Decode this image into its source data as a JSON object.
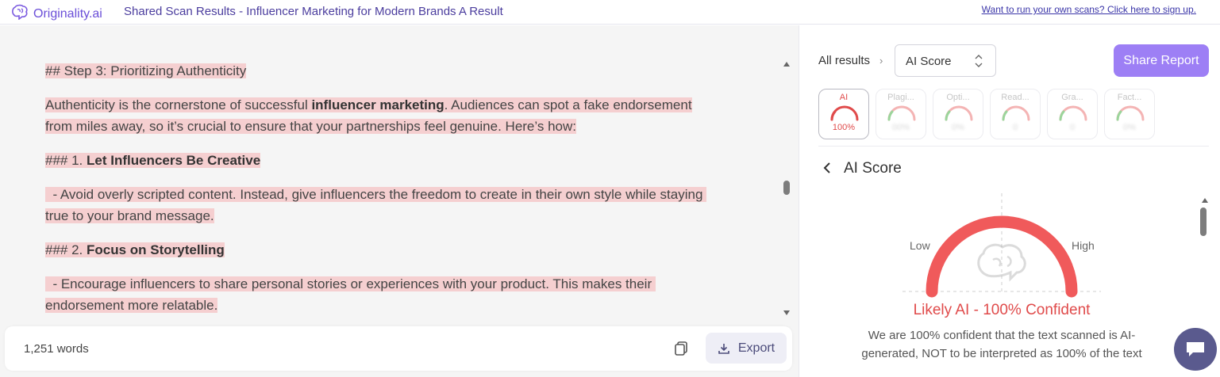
{
  "header": {
    "brand": "Originality.ai",
    "title": "Shared Scan Results - Influencer Marketing for Modern Brands A Result",
    "signup_link": "Want to run your own scans? Click here to sign up."
  },
  "document": {
    "p1": "## Step 3: Prioritizing Authenticity",
    "p2_a": "Authenticity is the cornerstone of successful ",
    "p2_bold": "influencer marketing",
    "p2_b": ". Audiences can spot a fake endorsement from miles away, so it’s crucial to ensure that your partnerships feel genuine. Here’s how:",
    "p3_prefix": "### 1. ",
    "p3_bold": "Let Influencers Be Creative",
    "p4": "  - Avoid overly scripted content. Instead, give influencers the freedom to create in their own style while staying true to your brand message.",
    "p5_prefix": "### 2. ",
    "p5_bold": "Focus on Storytelling",
    "p6": "  - Encourage influencers to share personal stories or experiences with your product. This makes their endorsement more relatable.",
    "highlight_color": "#f5cfd0"
  },
  "footer": {
    "word_count": "1,251 words",
    "copy_icon": "copy-icon",
    "export_label": "Export",
    "export_icon": "download-icon"
  },
  "results": {
    "breadcrumb_all": "All results",
    "breadcrumb_sep": "›",
    "select_value": "AI Score",
    "share_label": "Share Report",
    "accent": "#9d7ff5",
    "tabs": [
      {
        "label": "AI",
        "score": "100%",
        "active": true
      },
      {
        "label": "Plagi...",
        "score": "00%",
        "active": false
      },
      {
        "label": "Opti...",
        "score": "0%",
        "active": false
      },
      {
        "label": "Read...",
        "score": "0",
        "active": false
      },
      {
        "label": "Gra...",
        "score": "0",
        "active": false
      },
      {
        "label": "Fact...",
        "score": "0%",
        "active": false
      }
    ],
    "score_title": "AI Score",
    "gauge_low": "Low",
    "gauge_high": "High",
    "ai_confidence": 1.0,
    "verdict": "Likely AI - 100% Confident",
    "verdict_color": "#e04b4b",
    "description": "We are 100% confident that the text scanned is AI-generated, NOT to be interpreted as 100% of the text"
  }
}
